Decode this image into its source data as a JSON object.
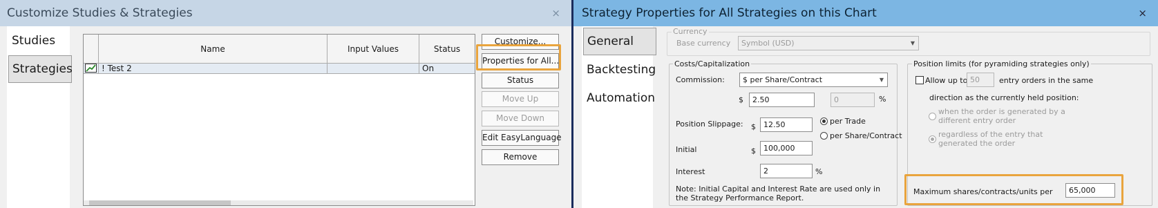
{
  "left": {
    "title": "Customize Studies & Strategies",
    "tabs": [
      "Studies",
      "Strategies"
    ],
    "grid": {
      "headers": [
        "Name",
        "Input Values",
        "Status"
      ],
      "row": {
        "name": "! Test 2",
        "input_values": "",
        "status": "On"
      }
    },
    "buttons": {
      "customize": "Customize...",
      "properties": "Properties for All...",
      "status": "Status",
      "move_up": "Move Up",
      "move_down": "Move Down",
      "edit_easylanguage": "Edit EasyLanguage",
      "remove": "Remove"
    }
  },
  "right": {
    "title": "Strategy Properties for All Strategies on this Chart",
    "tabs": [
      "General",
      "Backtesting",
      "Automation"
    ],
    "currency": {
      "group": "Currency",
      "label": "Base currency",
      "value": "Symbol (USD)"
    },
    "costs": {
      "group": "Costs/Capitalization",
      "commission_label": "Commission:",
      "commission_type": "$ per Share/Contract",
      "dollar": "$",
      "commission_value": "2.50",
      "commission_pct": "0",
      "percent": "%",
      "slippage_label": "Position Slippage:",
      "slippage_value": "12.50",
      "per_trade": "per Trade",
      "per_share": "per Share/Contract",
      "initial_label": "Initial",
      "initial_value": "100,000",
      "interest_label": "Interest",
      "interest_value": "2",
      "note_line1": "Note: Initial Capital and Interest Rate are used only in",
      "note_line2": "the Strategy Performance Report."
    },
    "limits": {
      "group": "Position limits (for pyramiding strategies only)",
      "allow_label": "Allow up to",
      "allow_value": "50",
      "entry_orders": "entry orders in the same",
      "direction": "direction as the currently held position:",
      "opt1_line1": "when the order is generated by a",
      "opt1_line2": "different entry order",
      "opt2_line1": "regardless of the entry that",
      "opt2_line2": "generated the order",
      "max_label": "Maximum shares/contracts/units per",
      "max_value": "65,000"
    },
    "close_symbol": "×"
  },
  "accent_color": "#e9a43d"
}
